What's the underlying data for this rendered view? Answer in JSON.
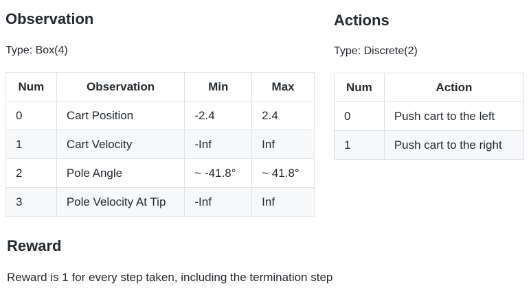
{
  "observation": {
    "heading": "Observation",
    "type": "Type: Box(4)",
    "columns": [
      "Num",
      "Observation",
      "Min",
      "Max"
    ],
    "rows": [
      [
        "0",
        "Cart Position",
        "-2.4",
        "2.4"
      ],
      [
        "1",
        "Cart Velocity",
        "-Inf",
        "Inf"
      ],
      [
        "2",
        "Pole Angle",
        "~ -41.8°",
        "~ 41.8°"
      ],
      [
        "3",
        "Pole Velocity At Tip",
        "-Inf",
        "Inf"
      ]
    ]
  },
  "actions": {
    "heading": "Actions",
    "type": "Type: Discrete(2)",
    "columns": [
      "Num",
      "Action"
    ],
    "rows": [
      [
        "0",
        "Push cart to the left"
      ],
      [
        "1",
        "Push cart to the right"
      ]
    ]
  },
  "reward": {
    "heading": "Reward",
    "text": "Reward is 1 for every step taken, including the termination step"
  }
}
